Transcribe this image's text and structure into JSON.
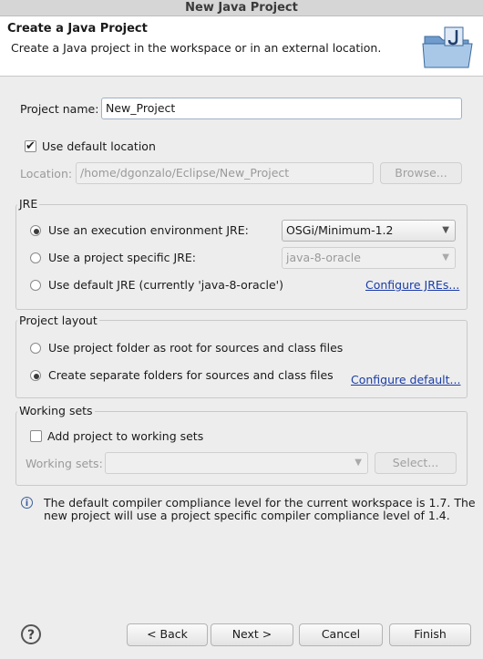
{
  "window": {
    "title": "New Java Project"
  },
  "header": {
    "title": "Create a Java Project",
    "subtitle": "Create a Java project in the workspace or in an external location.",
    "icon": "java-project-folder-icon"
  },
  "project_name": {
    "label": "Project name:",
    "value": "New_Project"
  },
  "location": {
    "use_default_label": "Use default location",
    "use_default_checked": true,
    "label": "Location:",
    "value": "/home/dgonzalo/Eclipse/New_Project",
    "browse_label": "Browse..."
  },
  "jre": {
    "group_title": "JRE",
    "option1_label": "Use an execution environment JRE:",
    "option1_value": "OSGi/Minimum-1.2",
    "option2_label": "Use a project specific JRE:",
    "option2_value": "java-8-oracle",
    "option3_label": "Use default JRE (currently 'java-8-oracle')",
    "configure_link": "Configure JREs...",
    "selected": 1
  },
  "layout": {
    "group_title": "Project layout",
    "option1_label": "Use project folder as root for sources and class files",
    "option2_label": "Create separate folders for sources and class files",
    "configure_link": "Configure default...",
    "selected": 2
  },
  "working_sets": {
    "group_title": "Working sets",
    "add_label": "Add project to working sets",
    "add_checked": false,
    "label": "Working sets:",
    "value": "",
    "select_label": "Select..."
  },
  "info": {
    "icon": "info-icon",
    "text_line1": "The default compiler compliance level for the current workspace is 1.7. The",
    "text_line2": "new project will use a project specific compiler compliance level of 1.4."
  },
  "footer": {
    "help_icon": "help-icon",
    "back_label": "< Back",
    "next_label": "Next >",
    "cancel_label": "Cancel",
    "finish_label": "Finish"
  }
}
